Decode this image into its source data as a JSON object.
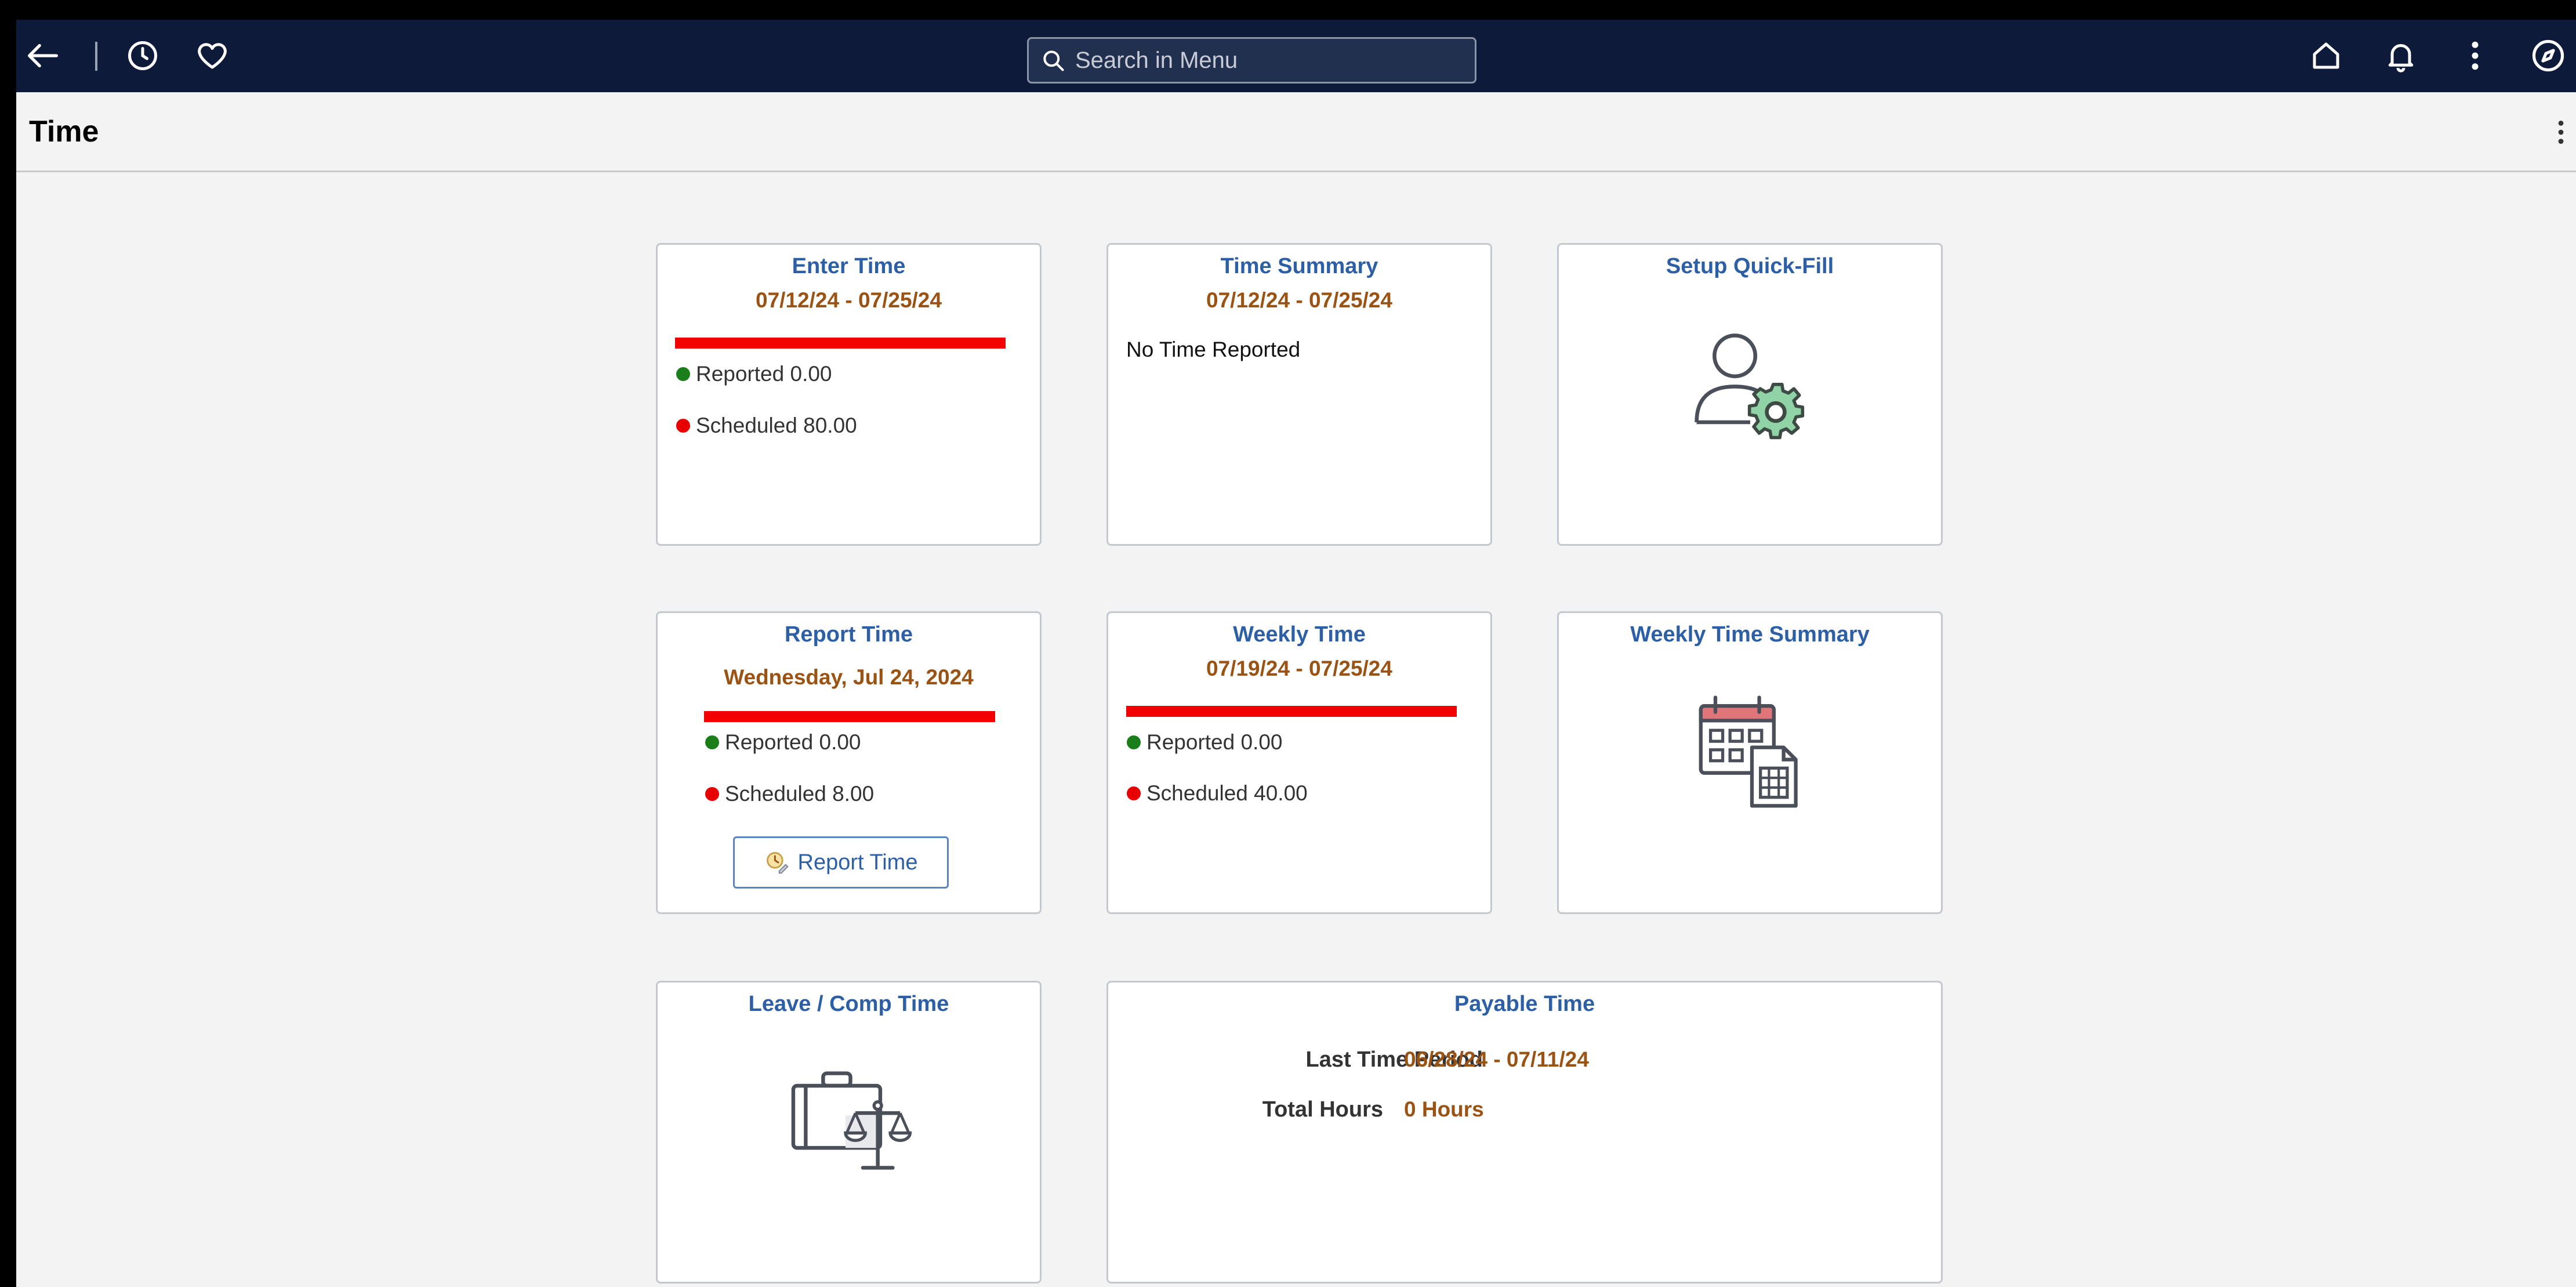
{
  "navbar": {
    "search_placeholder": "Search in Menu",
    "icons": [
      "back-arrow-icon",
      "history-icon",
      "favorites-heart-icon",
      "home-icon",
      "bell-icon",
      "more-vertical-icon",
      "navigator-compass-icon"
    ],
    "background_color": "#0d1a3a"
  },
  "header": {
    "title": "Time",
    "actions_icon": "more-vertical-icon"
  },
  "colors": {
    "tile_title": "#2d5fa6",
    "date_text": "#9a5313",
    "progress_bar": "#f20000",
    "reported_dot": "#1a7f1a",
    "scheduled_dot": "#e80000"
  },
  "tiles": {
    "enter_time": {
      "title": "Enter Time",
      "date_range": "07/12/24 - 07/25/24",
      "reported": "Reported 0.00",
      "scheduled": "Scheduled 80.00"
    },
    "time_summary": {
      "title": "Time Summary",
      "date_range": "07/12/24 - 07/25/24",
      "message": "No Time Reported"
    },
    "setup_quick_fill": {
      "title": "Setup Quick-Fill",
      "icon": "user-gear-icon"
    },
    "report_time": {
      "title": "Report Time",
      "date": "Wednesday, Jul 24, 2024",
      "reported": "Reported 0.00",
      "scheduled": "Scheduled 8.00",
      "button_label": "Report Time"
    },
    "weekly_time": {
      "title": "Weekly Time",
      "date_range": "07/19/24 - 07/25/24",
      "reported": "Reported 0.00",
      "scheduled": "Scheduled 40.00"
    },
    "weekly_time_summary": {
      "title": "Weekly Time Summary",
      "icon": "calendar-spreadsheet-icon"
    },
    "leave_comp_time": {
      "title": "Leave / Comp Time",
      "icon": "briefcase-scales-icon"
    },
    "payable_time": {
      "title": "Payable Time",
      "last_period_label": "Last Time Period",
      "last_period_value": "06/28/24 - 07/11/24",
      "total_hours_label": "Total Hours",
      "total_hours_value": "0 Hours"
    }
  }
}
